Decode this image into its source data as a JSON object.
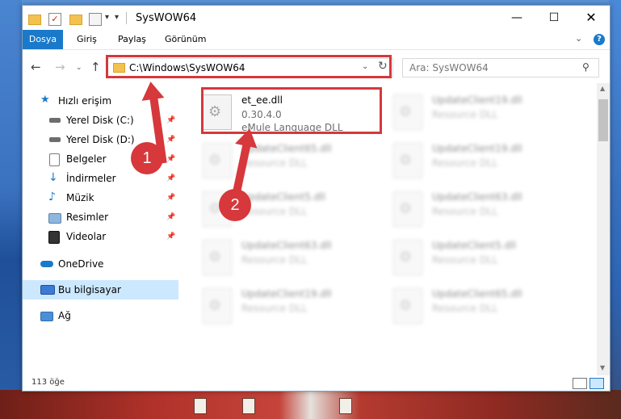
{
  "window": {
    "title": "SysWOW64",
    "controls": {
      "minimize": "—",
      "maximize": "☐",
      "close": "✕"
    }
  },
  "quick_access_toolbar": {
    "dropdown_glyph": "▾",
    "customize_glyph": "▾"
  },
  "ribbon": {
    "tabs": [
      {
        "label": "Dosya",
        "active": true
      },
      {
        "label": "Giriş"
      },
      {
        "label": "Paylaş"
      },
      {
        "label": "Görünüm"
      }
    ],
    "collapse_glyph": "⌄",
    "help_glyph": "?"
  },
  "navigation": {
    "back_glyph": "←",
    "forward_glyph": "→",
    "history_glyph": "⌄",
    "up_glyph": "↑",
    "address": "C:\\Windows\\SysWOW64",
    "address_dropdown_glyph": "⌄",
    "refresh_glyph": "↻",
    "search_placeholder": "Ara: SysWOW64",
    "search_glyph": "⚲"
  },
  "sidebar": {
    "items": [
      {
        "label": "Hızlı erişim",
        "icon": "star-icon",
        "pinned": false
      },
      {
        "label": "Yerel Disk (C:)",
        "icon": "drive-icon",
        "pinned": true
      },
      {
        "label": "Yerel Disk (D:)",
        "icon": "drive-icon",
        "pinned": true
      },
      {
        "label": "Belgeler",
        "icon": "documents-icon",
        "pinned": true
      },
      {
        "label": "İndirmeler",
        "icon": "download-icon",
        "pinned": true
      },
      {
        "label": "Müzik",
        "icon": "music-icon",
        "pinned": true
      },
      {
        "label": "Resimler",
        "icon": "pictures-icon",
        "pinned": true
      },
      {
        "label": "Videolar",
        "icon": "video-icon",
        "pinned": true
      },
      {
        "label": "OneDrive",
        "icon": "cloud-icon",
        "pinned": false
      },
      {
        "label": "Bu bilgisayar",
        "icon": "computer-icon",
        "selected": true
      },
      {
        "label": "Ağ",
        "icon": "network-icon",
        "pinned": false
      }
    ],
    "pin_glyph": "📌"
  },
  "files": [
    {
      "name": "et_ee.dll",
      "line2": "0.30.4.0",
      "line3": "eMule Language DLL",
      "blurred": false
    },
    {
      "name": "UpdateClient65.dll",
      "line2": "Resource DLL",
      "blurred": true
    },
    {
      "name": "UpdateClient5.dll",
      "line2": "Resource DLL",
      "blurred": true
    },
    {
      "name": "UpdateClient63.dll",
      "line2": "Resource DLL",
      "blurred": true
    },
    {
      "name": "UpdateClient19.dll",
      "line2": "Resource DLL",
      "blurred": true
    },
    {
      "name": "UpdateClient19.dll",
      "line2": "Resource DLL",
      "blurred": true
    },
    {
      "name": "UpdateClient19.dll",
      "line2": "Resource DLL",
      "blurred": true
    },
    {
      "name": "UpdateClient63.dll",
      "line2": "Resource DLL",
      "blurred": true
    },
    {
      "name": "UpdateClient5.dll",
      "line2": "Resource DLL",
      "blurred": true
    },
    {
      "name": "UpdateClient65.dll",
      "line2": "Resource DLL",
      "blurred": true
    }
  ],
  "scrollbar": {
    "up_glyph": "▲",
    "down_glyph": "▼"
  },
  "status": {
    "item_count": "113 öğe"
  },
  "annotations": {
    "step1": "1",
    "step2": "2",
    "highlight_color": "#d6383b"
  },
  "colors": {
    "accent": "#1979ca",
    "selection": "#cce8ff"
  }
}
